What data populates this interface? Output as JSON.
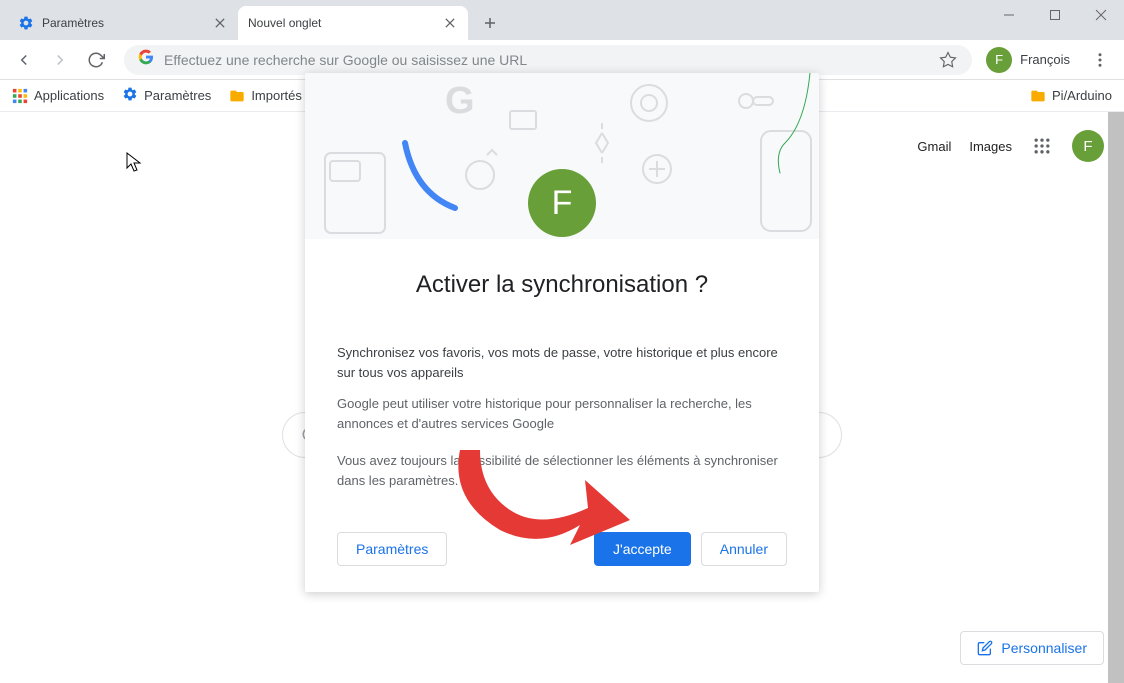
{
  "window": {
    "tabs": [
      {
        "title": "Paramètres",
        "active": false,
        "icon": "gear"
      },
      {
        "title": "Nouvel onglet",
        "active": true,
        "icon": "none"
      }
    ]
  },
  "toolbar": {
    "omnibox_placeholder": "Effectuez une recherche sur Google ou saisissez une URL",
    "profile_name": "François",
    "profile_initial": "F"
  },
  "bookmarks": {
    "apps": "Applications",
    "items": [
      {
        "label": "Paramètres",
        "icon": "gear"
      },
      {
        "label": "Importés de…",
        "icon": "folder"
      }
    ],
    "right": "Pi/Arduino"
  },
  "ntp": {
    "gmail": "Gmail",
    "images": "Images",
    "customize": "Personnaliser",
    "avatar_initial": "F"
  },
  "modal": {
    "avatar_initial": "F",
    "title": "Activer la synchronisation ?",
    "text1": "Synchronisez vos favoris, vos mots de passe, votre historique et plus encore sur tous vos appareils",
    "text2": "Google peut utiliser votre historique pour personnaliser la recherche, les annonces et d'autres services Google",
    "text3": "Vous avez toujours la possibilité de sélectionner les éléments à synchroniser dans les paramètres.",
    "settings_btn": "Paramètres",
    "accept_btn": "J'accepte",
    "cancel_btn": "Annuler"
  }
}
